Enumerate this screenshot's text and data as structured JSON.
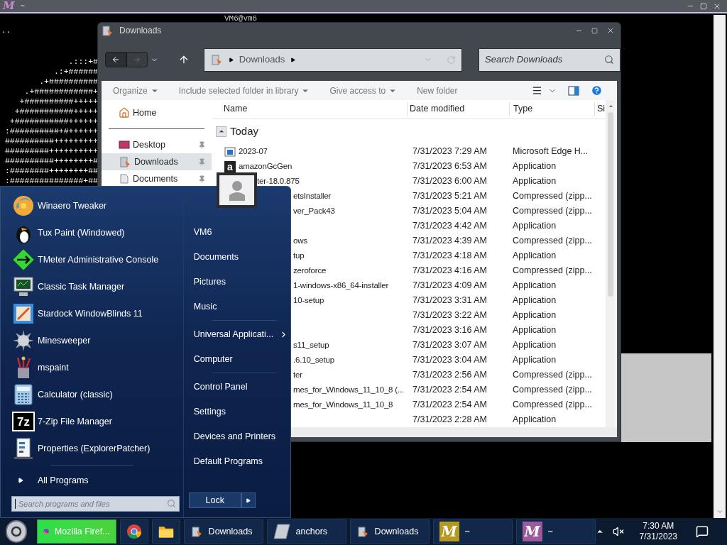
{
  "terminal": {
    "logo": "M",
    "title": "~",
    "heading": "VM6@vm6",
    "prompt": "..",
    "art": [
      "              .:::+#",
      "           .:+######",
      "        .+##########",
      "     .+############+",
      "    +##########+++++",
      "   +###########+++++",
      "  +###########++++++",
      " :##########+#++++++",
      " ##########+++++++++",
      " #########++++++++++",
      " ##########++++++++#",
      " :########++++++++##",
      " :###############+##"
    ]
  },
  "explorer": {
    "title": "Downloads",
    "address": "Downloads",
    "search_placeholder": "Search Downloads",
    "commands": [
      "Organize",
      "Include selected folder in library",
      "Give access to",
      "New folder"
    ],
    "nav": [
      {
        "label": "Home",
        "kind": "home",
        "pinned": false,
        "selected": false,
        "separator_after": true
      },
      {
        "label": "Desktop",
        "kind": "desktop",
        "pinned": true,
        "selected": false,
        "separator_after": false
      },
      {
        "label": "Downloads",
        "kind": "downloads",
        "pinned": true,
        "selected": true,
        "separator_after": false
      },
      {
        "label": "Documents",
        "kind": "documents",
        "pinned": true,
        "selected": false,
        "separator_after": false
      }
    ],
    "columns": [
      "Name",
      "Date modified",
      "Type",
      "Si"
    ],
    "group": "Today",
    "rows": [
      {
        "name": "2023-07",
        "kind": "page",
        "date": "7/31/2023 7:29 AM",
        "type": "Microsoft Edge H..."
      },
      {
        "name": "amazonGcGen",
        "kind": "letter",
        "icon_text": "a",
        "date": "7/31/2023 6:53 AM",
        "type": "Application"
      },
      {
        "name": "ter-18.0.875",
        "kind": "under_picture",
        "date": "7/31/2023 6:00 AM",
        "type": "Application"
      },
      {
        "name": "etsInstaller",
        "kind": "under_menu",
        "date": "7/31/2023 5:21 AM",
        "type": "Compressed (zipp..."
      },
      {
        "name": "ver_Pack43",
        "kind": "under_menu",
        "date": "7/31/2023 5:04 AM",
        "type": "Compressed (zipp..."
      },
      {
        "kind": "under_menu",
        "date": "7/31/2023 4:42 AM",
        "type": "Application"
      },
      {
        "name": "ows",
        "kind": "under_menu",
        "date": "7/31/2023 4:39 AM",
        "type": "Compressed (zipp..."
      },
      {
        "name": "tup",
        "kind": "under_menu",
        "date": "7/31/2023 4:18 AM",
        "type": "Application"
      },
      {
        "name": "zeroforce",
        "kind": "under_menu",
        "date": "7/31/2023 4:16 AM",
        "type": "Compressed (zipp..."
      },
      {
        "name": "1-windows-x86_64-installer",
        "kind": "under_menu",
        "date": "7/31/2023 4:09 AM",
        "type": "Application"
      },
      {
        "name": "10-setup",
        "kind": "under_menu",
        "date": "7/31/2023 3:31 AM",
        "type": "Application"
      },
      {
        "kind": "under_menu",
        "date": "7/31/2023 3:22 AM",
        "type": "Application"
      },
      {
        "kind": "under_menu",
        "date": "7/31/2023 3:16 AM",
        "type": "Application"
      },
      {
        "name": "s11_setup",
        "kind": "under_menu",
        "date": "7/31/2023 3:07 AM",
        "type": "Application"
      },
      {
        "name": ".6.10_setup",
        "kind": "under_menu",
        "date": "7/31/2023 3:04 AM",
        "type": "Application"
      },
      {
        "name": "ter",
        "kind": "under_menu",
        "date": "7/31/2023 2:56 AM",
        "type": "Compressed (zipp..."
      },
      {
        "name": "mes_for_Windows_11_10_8 (...",
        "kind": "under_menu",
        "date": "7/31/2023 2:54 AM",
        "type": "Compressed (zipp..."
      },
      {
        "name": "mes_for_Windows_11_10_8",
        "kind": "under_menu",
        "date": "7/31/2023 2:54 AM",
        "type": "Compressed (zipp..."
      },
      {
        "kind": "under_menu",
        "date": "7/31/2023 2:28 AM",
        "type": "Application"
      }
    ]
  },
  "start_menu": {
    "programs": [
      {
        "label": "Winaero Tweaker",
        "kind": "swirl"
      },
      {
        "label": "Tux Paint (Windowed)",
        "kind": "penguin"
      },
      {
        "label": "TMeter Administrative Console",
        "kind": "diamond"
      },
      {
        "label": "Classic Task Manager",
        "kind": "monitor"
      },
      {
        "label": "Stardock WindowBlinds 11",
        "kind": "frame"
      },
      {
        "label": "Minesweeper",
        "kind": "mine"
      },
      {
        "label": "mspaint",
        "kind": "brushes"
      },
      {
        "label": "Calculator (classic)",
        "kind": "calculator"
      },
      {
        "label": "7-Zip File Manager",
        "kind": "tile",
        "icon_text": "7z"
      },
      {
        "label": "Properties (ExplorerPatcher)",
        "kind": "sheet"
      }
    ],
    "all_programs": "All Programs",
    "places": [
      {
        "label": "VM6",
        "submenu": false,
        "separator_after": false
      },
      {
        "label": "Documents",
        "submenu": false,
        "separator_after": false
      },
      {
        "label": "Pictures",
        "submenu": false,
        "separator_after": false
      },
      {
        "label": "Music",
        "submenu": false,
        "separator_after": true
      },
      {
        "label": "Universal Applicati...",
        "submenu": true,
        "separator_after": false
      },
      {
        "label": "Computer",
        "submenu": false,
        "separator_after": true
      },
      {
        "label": "Control Panel",
        "submenu": false,
        "separator_after": false
      },
      {
        "label": "Settings",
        "submenu": false,
        "separator_after": false
      },
      {
        "label": "Devices and Printers",
        "submenu": false,
        "separator_after": false
      },
      {
        "label": "Default Programs",
        "submenu": false,
        "separator_after": false
      }
    ],
    "search_placeholder": "Search programs and files",
    "lock": "Lock"
  },
  "taskbar": {
    "items": [
      {
        "kind": "firefox",
        "label": "Mozilla Firef...",
        "flashing": true
      },
      {
        "kind": "chrome",
        "flashing": false
      },
      {
        "kind": "folder",
        "flashing": false
      },
      {
        "kind": "explorer",
        "label": "Downloads",
        "flashing": false
      },
      {
        "kind": "glass",
        "label": "anchors",
        "flashing": false
      },
      {
        "kind": "explorer",
        "label": "Downloads",
        "flashing": false
      },
      {
        "kind": "logo",
        "icon_text": "M",
        "color": "#b59a1e",
        "label": "~",
        "flashing": false
      },
      {
        "kind": "logo",
        "icon_text": "M",
        "color": "#9c5a9c",
        "label": "~",
        "flashing": false
      }
    ],
    "time": "7:30 AM",
    "date": "7/31/2023"
  }
}
